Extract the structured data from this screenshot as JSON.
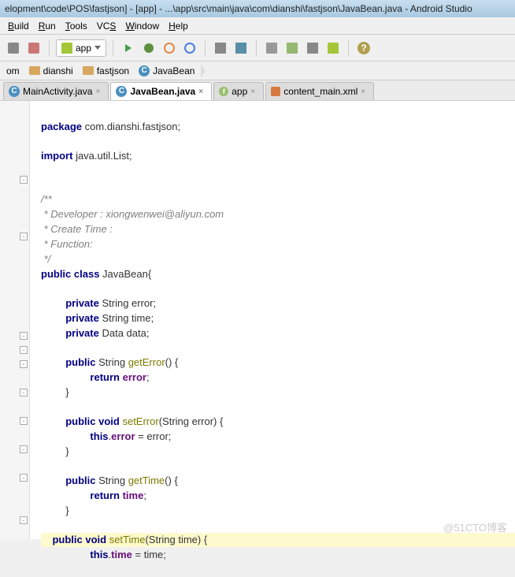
{
  "window": {
    "title": "elopment\\code\\POS\\fastjson] - [app] - ...\\app\\src\\main\\java\\com\\dianshi\\fastjson\\JavaBean.java - Android Studio"
  },
  "menu": {
    "build": "Build",
    "run": "Run",
    "tools": "Tools",
    "vcs": "VCS",
    "window": "Window",
    "help": "Help"
  },
  "toolbar": {
    "module": "app"
  },
  "breadcrumb": {
    "c0": "om",
    "c1": "dianshi",
    "c2": "fastjson",
    "c3": "JavaBean"
  },
  "tabs": {
    "t0": "MainActivity.java",
    "t1": "JavaBean.java",
    "t2": "app",
    "t3": "content_main.xml"
  },
  "code": {
    "l1a": "package",
    "l1b": " com.dianshi.fastjson;",
    "l2a": "import",
    "l2b": " java.util.List;",
    "l3": "/**",
    "l4": " * Developer : xiongwenwei@aliyun.com",
    "l5": " * Create Time :",
    "l6": " * Function:",
    "l7": " */",
    "l8a": "public class",
    "l8b": " JavaBean{",
    "l9a": "private",
    "l9b": " String error;",
    "l10a": "private",
    "l10b": " String time;",
    "l11a": "private",
    "l11b": " Data data;",
    "l12a": "public",
    "l12b": " String ",
    "l12c": "getError",
    "l12d": "() {",
    "l13a": "return",
    "l13b": " error",
    "l13c": ";",
    "l14": "}",
    "l15a": "public void",
    "l15b": " ",
    "l15c": "setError",
    "l15d": "(String error) {",
    "l16a": "this",
    "l16b": ".",
    "l16c": "error",
    "l16d": " = error;",
    "l17": "}",
    "l18a": "public",
    "l18b": " String ",
    "l18c": "getTime",
    "l18d": "() {",
    "l19a": "return",
    "l19b": " time",
    "l19c": ";",
    "l20": "}",
    "l21a": "public void",
    "l21b": " ",
    "l21c": "setTime",
    "l21d": "(String time) {",
    "l22a": "this",
    "l22b": ".",
    "l22c": "time",
    "l22d": " = time;"
  },
  "watermark": "@51CTO博客"
}
